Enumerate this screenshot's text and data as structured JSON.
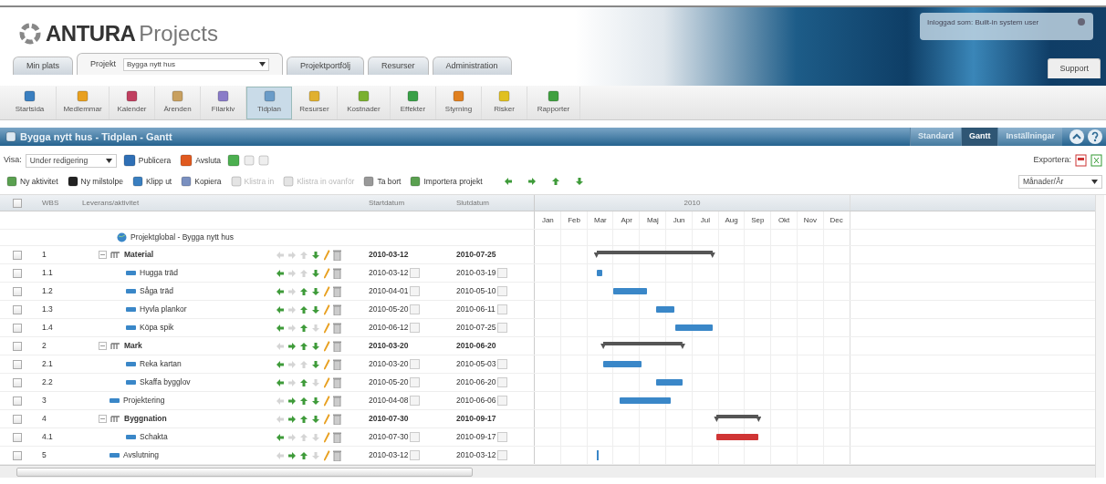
{
  "logo": {
    "bold": "ANTURA",
    "light": "Projects"
  },
  "user_box": {
    "text": "Inloggad som: Built-in system user"
  },
  "support_button": "Support",
  "main_tabs": [
    {
      "label": "Min plats",
      "selected": false
    },
    {
      "label": "Projekt",
      "selected": true,
      "select_value": "Bygga nytt hus"
    },
    {
      "label": "Projektportfölj",
      "selected": false
    },
    {
      "label": "Resurser",
      "selected": false
    },
    {
      "label": "Administration",
      "selected": false
    }
  ],
  "modules": [
    {
      "label": "Startsida",
      "selected": false
    },
    {
      "label": "Medlemmar",
      "selected": false
    },
    {
      "label": "Kalender",
      "selected": false
    },
    {
      "label": "Ärenden",
      "selected": false
    },
    {
      "label": "Filarkiv",
      "selected": false
    },
    {
      "label": "Tidplan",
      "selected": true
    },
    {
      "label": "Resurser",
      "selected": false
    },
    {
      "label": "Kostnader",
      "selected": false
    },
    {
      "label": "Effekter",
      "selected": false
    },
    {
      "label": "Styrning",
      "selected": false
    },
    {
      "label": "Risker",
      "selected": false
    },
    {
      "label": "Rapporter",
      "selected": false
    }
  ],
  "title_bar": {
    "title": "Bygga nytt hus - Tidplan - Gantt",
    "views": [
      {
        "label": "Standard",
        "selected": false
      },
      {
        "label": "Gantt",
        "selected": true
      },
      {
        "label": "Inställningar",
        "selected": false
      }
    ]
  },
  "view_row": {
    "label": "Visa:",
    "select_value": "Under redigering",
    "buttons": [
      "Publicera",
      "Avsluta"
    ],
    "export_label": "Exportera:"
  },
  "actions": [
    {
      "label": "Ny aktivitet",
      "disabled": false
    },
    {
      "label": "Ny milstolpe",
      "disabled": false
    },
    {
      "label": "Klipp ut",
      "disabled": false
    },
    {
      "label": "Kopiera",
      "disabled": false
    },
    {
      "label": "Klistra in",
      "disabled": true
    },
    {
      "label": "Klistra in ovanför",
      "disabled": true
    },
    {
      "label": "Ta bort",
      "disabled": false
    },
    {
      "label": "Importera projekt",
      "disabled": false
    }
  ],
  "scale_select": "Månader/År",
  "table": {
    "select_all_checked": false,
    "columns": [
      "WBS",
      "Leverans/aktivitet",
      "Startdatum",
      "Slutdatum"
    ],
    "root": {
      "name": "Projektglobal - Bygga nytt hus"
    },
    "rows": [
      {
        "kind": "summary",
        "checked": false,
        "expanded": true,
        "wbs": "1",
        "name": "Material",
        "start": "2010-03-12",
        "end": "2010-07-25",
        "moves": [
          false,
          false,
          false,
          true
        ],
        "children": [
          {
            "kind": "task",
            "checked": false,
            "wbs": "1.1",
            "name": "Hugga träd",
            "start": "2010-03-12",
            "end": "2010-03-19",
            "color": "#3a87c8",
            "moves": [
              true,
              false,
              false,
              true
            ]
          },
          {
            "kind": "task",
            "checked": false,
            "wbs": "1.2",
            "name": "Såga träd",
            "start": "2010-04-01",
            "end": "2010-05-10",
            "color": "#3a87c8",
            "moves": [
              true,
              false,
              true,
              true
            ]
          },
          {
            "kind": "task",
            "checked": false,
            "wbs": "1.3",
            "name": "Hyvla plankor",
            "start": "2010-05-20",
            "end": "2010-06-11",
            "color": "#3a87c8",
            "moves": [
              true,
              false,
              true,
              true
            ]
          },
          {
            "kind": "task",
            "checked": false,
            "wbs": "1.4",
            "name": "Köpa spik",
            "start": "2010-06-12",
            "end": "2010-07-25",
            "color": "#3a87c8",
            "moves": [
              true,
              false,
              true,
              false
            ]
          }
        ]
      },
      {
        "kind": "summary",
        "checked": false,
        "expanded": true,
        "wbs": "2",
        "name": "Mark",
        "start": "2010-03-20",
        "end": "2010-06-20",
        "moves": [
          false,
          true,
          true,
          true
        ],
        "children": [
          {
            "kind": "task",
            "checked": false,
            "wbs": "2.1",
            "name": "Reka kartan",
            "start": "2010-03-20",
            "end": "2010-05-03",
            "color": "#3a87c8",
            "moves": [
              true,
              false,
              false,
              true
            ]
          },
          {
            "kind": "task",
            "checked": false,
            "wbs": "2.2",
            "name": "Skaffa bygglov",
            "start": "2010-05-20",
            "end": "2010-06-20",
            "color": "#3a87c8",
            "moves": [
              true,
              false,
              true,
              false
            ]
          }
        ]
      },
      {
        "kind": "task",
        "checked": false,
        "wbs": "3",
        "name": "Projektering",
        "start": "2010-04-08",
        "end": "2010-06-06",
        "color": "#3a87c8",
        "moves": [
          false,
          true,
          true,
          true
        ]
      },
      {
        "kind": "summary",
        "checked": false,
        "expanded": true,
        "wbs": "4",
        "name": "Byggnation",
        "start": "2010-07-30",
        "end": "2010-09-17",
        "moves": [
          false,
          true,
          true,
          true
        ],
        "children": [
          {
            "kind": "task",
            "checked": false,
            "wbs": "4.1",
            "name": "Schakta",
            "start": "2010-07-30",
            "end": "2010-09-17",
            "color": "#d03535",
            "moves": [
              true,
              false,
              false,
              false
            ]
          }
        ]
      },
      {
        "kind": "milestone",
        "checked": false,
        "wbs": "5",
        "name": "Avslutning",
        "start": "2010-03-12",
        "end": "2010-03-12",
        "color": "#3a87c8",
        "moves": [
          false,
          true,
          true,
          false
        ]
      }
    ]
  },
  "gantt": {
    "year": "2010",
    "months": [
      "Jan",
      "Feb",
      "Mar",
      "Apr",
      "Maj",
      "Jun",
      "Jul",
      "Aug",
      "Sep",
      "Okt",
      "Nov",
      "Dec"
    ]
  }
}
